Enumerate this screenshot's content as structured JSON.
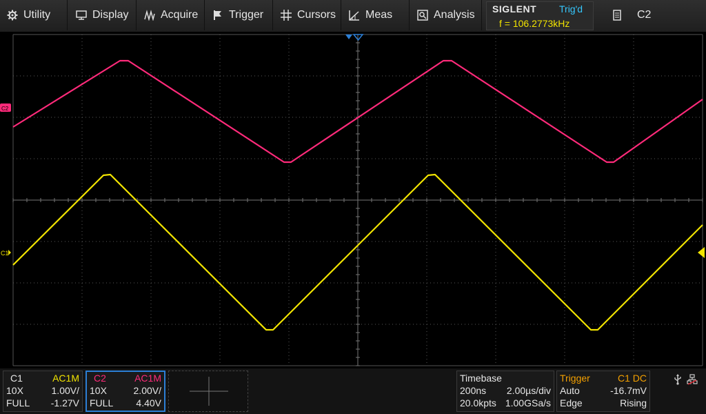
{
  "menu": {
    "items": [
      {
        "label": "Utility",
        "icon": "gear-icon"
      },
      {
        "label": "Display",
        "icon": "monitor-icon"
      },
      {
        "label": "Acquire",
        "icon": "acquire-icon"
      },
      {
        "label": "Trigger",
        "icon": "flag-icon"
      },
      {
        "label": "Cursors",
        "icon": "cursors-icon"
      },
      {
        "label": "Meas",
        "icon": "measure-icon"
      },
      {
        "label": "Analysis",
        "icon": "analysis-icon"
      }
    ]
  },
  "brand": "SIGLENT",
  "trigger_status": "Trig'd",
  "frequency_readout": "f = 106.2773kHz",
  "selected_channel": "C2",
  "markers": {
    "c1": "C1",
    "c2": "C2"
  },
  "colors": {
    "c1": "#f2e400",
    "c2": "#ff2a7a",
    "trigger": "#f4a000",
    "accent": "#2c7fd6",
    "grid": "#5a5a5a"
  },
  "channels": {
    "c1": {
      "name": "C1",
      "coupling": "AC1M",
      "probe": "10X",
      "scale": "1.00V/",
      "bandwidth": "FULL",
      "offset": "-1.27V"
    },
    "c2": {
      "name": "C2",
      "coupling": "AC1M",
      "probe": "10X",
      "scale": "2.00V/",
      "bandwidth": "FULL",
      "offset": "4.40V"
    }
  },
  "timebase": {
    "title": "Timebase",
    "delay": "200ns",
    "scale": "2.00µs/div",
    "points": "20.0kpts",
    "rate": "1.00GSa/s"
  },
  "trigger": {
    "title": "Trigger",
    "source": "C1 DC",
    "mode": "Auto",
    "level": "-16.7mV",
    "type": "Edge",
    "slope": "Rising"
  }
}
